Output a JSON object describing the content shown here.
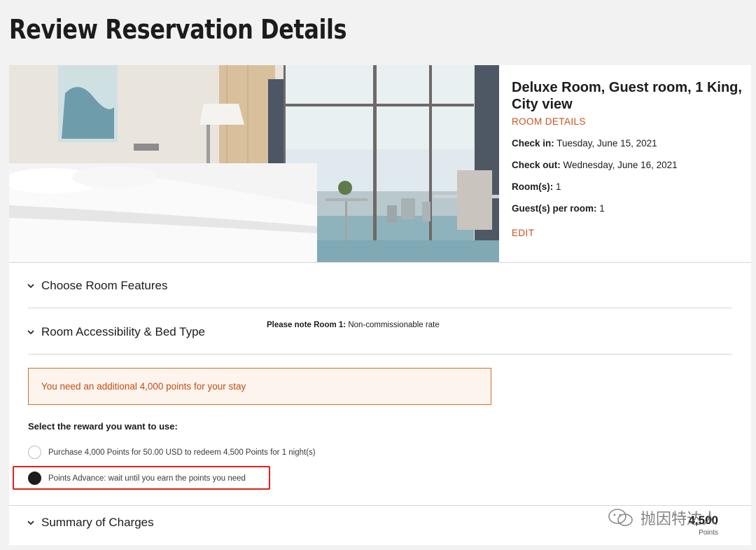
{
  "page": {
    "title": "Review Reservation Details"
  },
  "room": {
    "title": "Deluxe Room, Guest room, 1 King, City view",
    "details_link": "ROOM DETAILS",
    "check_in_label": "Check in:",
    "check_in_value": "Tuesday, June 15, 2021",
    "check_out_label": "Check out:",
    "check_out_value": "Wednesday, June 16, 2021",
    "rooms_label": "Room(s):",
    "rooms_value": "1",
    "guests_label": "Guest(s) per room:",
    "guests_value": "1",
    "edit_link": "EDIT"
  },
  "accordions": {
    "room_features": "Choose Room Features",
    "accessibility": "Room Accessibility & Bed Type",
    "summary": "Summary of Charges"
  },
  "note": {
    "label": "Please note Room 1:",
    "value": "Non-commissionable rate"
  },
  "alert": {
    "text": "You need an additional 4,000 points for your stay"
  },
  "reward": {
    "label": "Select the reward you want to use:",
    "options": [
      {
        "label": "Purchase 4,000 Points for 50.00 USD to redeem 4,500 Points for 1 night(s)",
        "selected": false
      },
      {
        "label": "Points Advance: wait until you earn the points you need",
        "selected": true
      }
    ]
  },
  "summary": {
    "points_value": "4,500",
    "points_unit": "Points"
  },
  "watermark": {
    "icon": "wechat-icon",
    "text": "抛因特达人"
  },
  "colors": {
    "accent": "#c9501c",
    "alert_bg": "#fcf4ed",
    "highlight": "#e0201a"
  }
}
